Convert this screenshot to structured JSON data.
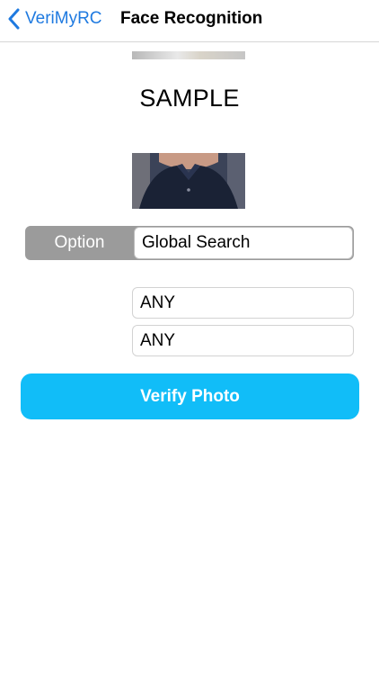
{
  "nav": {
    "back_label": "VeriMyRC",
    "title": "Face Recognition"
  },
  "main": {
    "sample_label": "SAMPLE",
    "option": {
      "label": "Option",
      "value": "Global Search"
    },
    "fields": [
      {
        "value": "ANY"
      },
      {
        "value": "ANY"
      }
    ],
    "verify_button": "Verify Photo"
  },
  "colors": {
    "accent": "#1f7ae0",
    "button": "#11bdf8",
    "option_bg": "#9b9b9b"
  },
  "icons": {
    "back": "chevron-left-icon"
  }
}
